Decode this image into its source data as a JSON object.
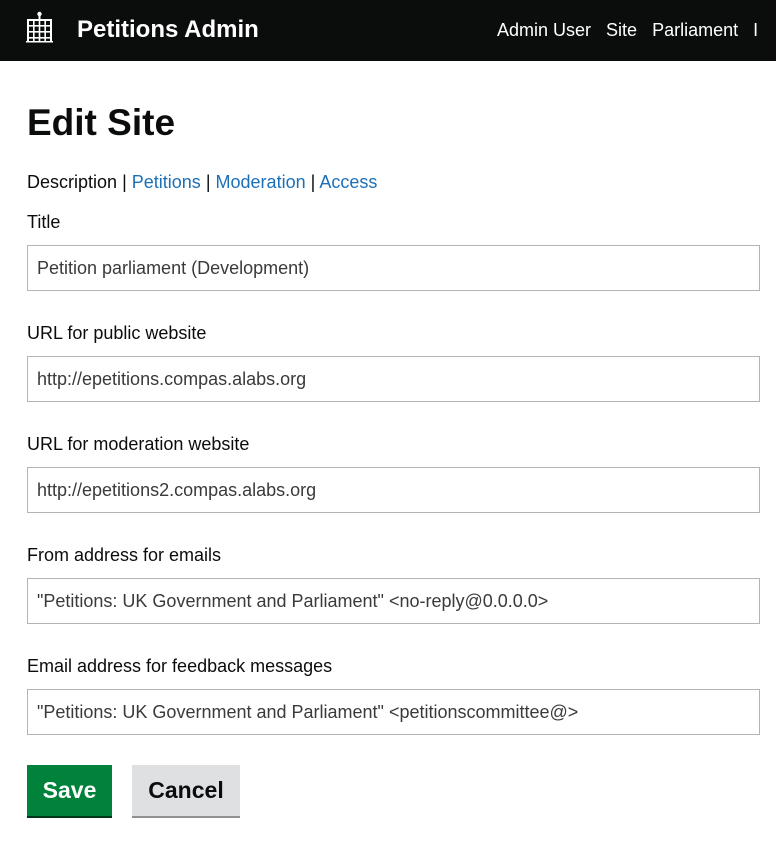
{
  "header": {
    "app_title": "Petitions Admin",
    "logo_icon": "portcullis-icon",
    "nav": [
      "Admin User",
      "Site",
      "Parliament",
      "I"
    ]
  },
  "page": {
    "title": "Edit Site"
  },
  "tabs": {
    "current": "Description",
    "links": [
      "Petitions",
      "Moderation",
      "Access"
    ],
    "separator": "|"
  },
  "form": {
    "fields": [
      {
        "label": "Title",
        "value": "Petition parliament (Development)"
      },
      {
        "label": "URL for public website",
        "value": "http://epetitions.compas.alabs.org"
      },
      {
        "label": "URL for moderation website",
        "value": "http://epetitions2.compas.alabs.org"
      },
      {
        "label": "From address for emails",
        "value": "\"Petitions: UK Government and Parliament\" <no-reply@0.0.0.0>"
      },
      {
        "label": "Email address for feedback messages",
        "value": "\"Petitions: UK Government and Parliament\" <petitionscommittee@>"
      }
    ],
    "save_label": "Save",
    "cancel_label": "Cancel"
  },
  "colors": {
    "header_bg": "#0b0c0c",
    "link": "#1d70b8",
    "save_button": "#00823b",
    "cancel_button": "#dee0e2"
  }
}
